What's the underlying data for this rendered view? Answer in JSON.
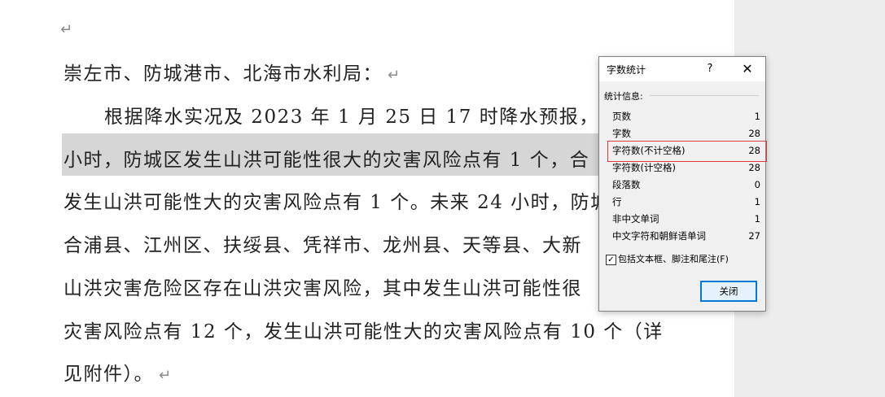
{
  "document": {
    "lines": [
      "崇左市、防城港市、北海市水利局：",
      "根据降水实况及 2023 年 1 月 25 日 17 时降水预报，未",
      "小时，防城区发生山洪可能性很大的灾害风险点有 1 个，合",
      "发生山洪可能性大的灾害风险点有 1 个。未来 24 小时，防城",
      "合浦县、江州区、扶绥县、凭祥市、龙州县、天等县、大新",
      "山洪灾害危险区存在山洪灾害风险，其中发生山洪可能性很",
      "灾害风险点有 12 个，发生山洪可能性大的灾害风险点有 10 个（详",
      "见附件）。"
    ],
    "paragraph_mark": "↵"
  },
  "dialog": {
    "title": "字数统计",
    "help": "?",
    "close_icon": "✕",
    "section_label": "统计信息:",
    "rows": [
      {
        "label": "页数",
        "value": "1"
      },
      {
        "label": "字数",
        "value": "28"
      },
      {
        "label": "字符数(不计空格)",
        "value": "28"
      },
      {
        "label": "字符数(计空格)",
        "value": "28"
      },
      {
        "label": "段落数",
        "value": "0"
      },
      {
        "label": "行",
        "value": "1"
      },
      {
        "label": "非中文单词",
        "value": "1"
      },
      {
        "label": "中文字符和朝鲜语单词",
        "value": "27"
      }
    ],
    "checkbox_label": "包括文本框、脚注和尾注(F)",
    "checkbox_mark": "✓",
    "close_button": "关闭"
  }
}
